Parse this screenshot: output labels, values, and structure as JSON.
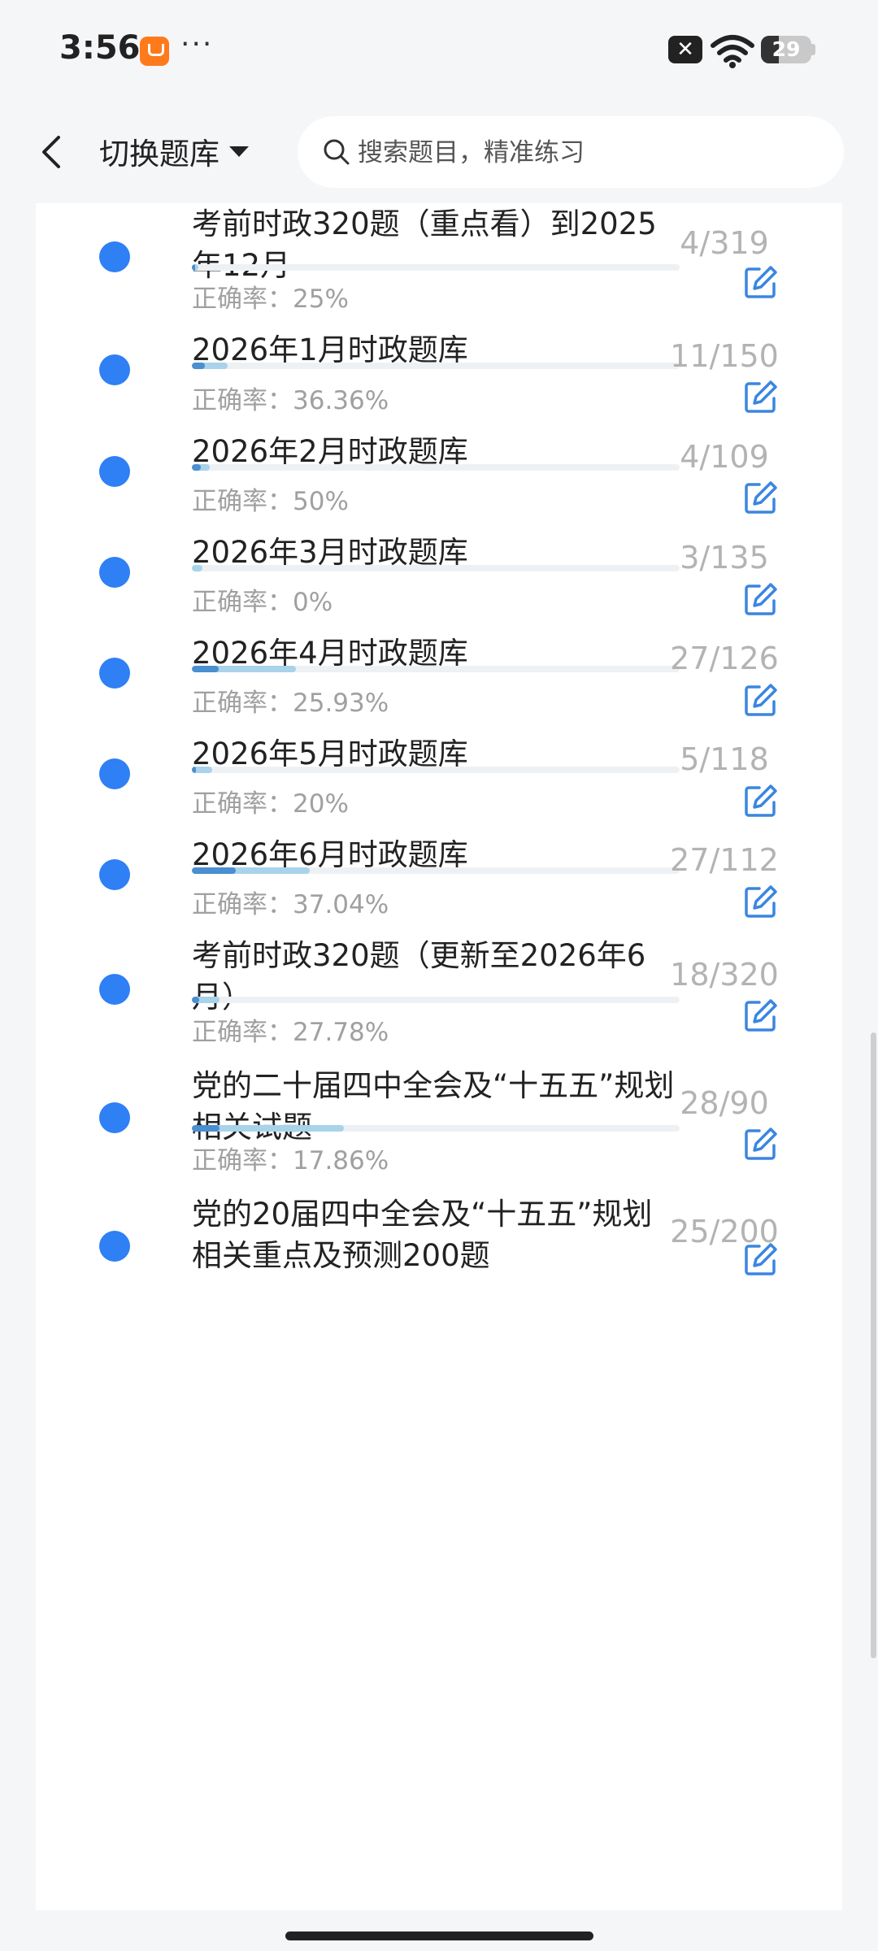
{
  "status": {
    "time": "3:56",
    "more": "···",
    "battery": "29"
  },
  "header": {
    "switch_label": "切换题库",
    "search_placeholder": "搜索题目，精准练习"
  },
  "items": [
    {
      "title": "",
      "rate": "正确率：0%",
      "count": "",
      "progress": 0.01,
      "correct_share": 0.0
    },
    {
      "title": "考前时政320题（重点看）到2025年12月",
      "rate": "正确率：25%",
      "count": "4/319",
      "progress": 0.013,
      "correct_share": 0.25
    },
    {
      "title": "2026年1月时政题库",
      "rate": "正确率：36.36%",
      "count": "11/150",
      "progress": 0.073,
      "correct_share": 0.36
    },
    {
      "title": "2026年2月时政题库",
      "rate": "正确率：50%",
      "count": "4/109",
      "progress": 0.037,
      "correct_share": 0.5
    },
    {
      "title": "2026年3月时政题库",
      "rate": "正确率：0%",
      "count": "3/135",
      "progress": 0.022,
      "correct_share": 0.0
    },
    {
      "title": "2026年4月时政题库",
      "rate": "正确率：25.93%",
      "count": "27/126",
      "progress": 0.214,
      "correct_share": 0.26
    },
    {
      "title": "2026年5月时政题库",
      "rate": "正确率：20%",
      "count": "5/118",
      "progress": 0.042,
      "correct_share": 0.2
    },
    {
      "title": "2026年6月时政题库",
      "rate": "正确率：37.04%",
      "count": "27/112",
      "progress": 0.241,
      "correct_share": 0.37
    },
    {
      "title": "考前时政320题（更新至2026年6月）",
      "rate": "正确率：27.78%",
      "count": "18/320",
      "progress": 0.056,
      "correct_share": 0.28
    },
    {
      "title": "党的二十届四中全会及“十五五”规划相关试题",
      "rate": "正确率：17.86%",
      "count": "28/90",
      "progress": 0.311,
      "correct_share": 0.18
    },
    {
      "title": "党的20届四中全会及“十五五”规划相关重点及预测200题",
      "rate": "",
      "count": "25/200",
      "progress": 0.125,
      "correct_share": 0.0
    }
  ]
}
